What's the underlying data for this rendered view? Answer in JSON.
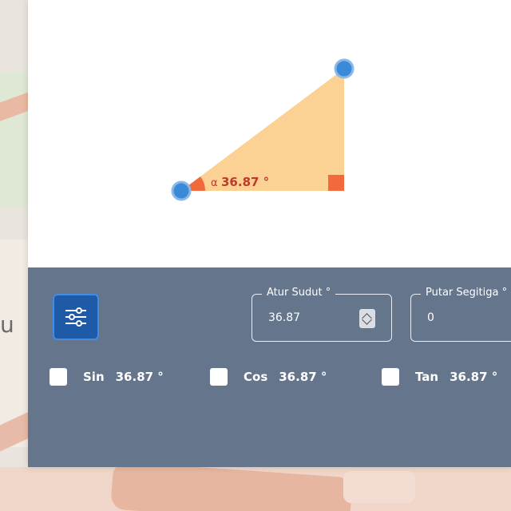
{
  "triangle": {
    "angle_symbol": "α",
    "angle_value": "36.87 °"
  },
  "controls": {
    "set_angle": {
      "label": "Atur Sudut °",
      "value": "36.87"
    },
    "rotate": {
      "label": "Putar Segitiga °",
      "value": "0"
    }
  },
  "trig": [
    {
      "name": "Sin",
      "value": "36.87 °"
    },
    {
      "name": "Cos",
      "value": "36.87 °"
    },
    {
      "name": "Tan",
      "value": "36.87 °"
    }
  ],
  "colors": {
    "triangle_fill": "#fcd08e",
    "angle_marker": "#f26a3c",
    "handle": "#3a8ad8",
    "panel": "#65758c",
    "settings_button": "#1f5aa8"
  },
  "icons": {
    "settings": "sliders-icon"
  },
  "background": {
    "partial_letter": "u"
  }
}
